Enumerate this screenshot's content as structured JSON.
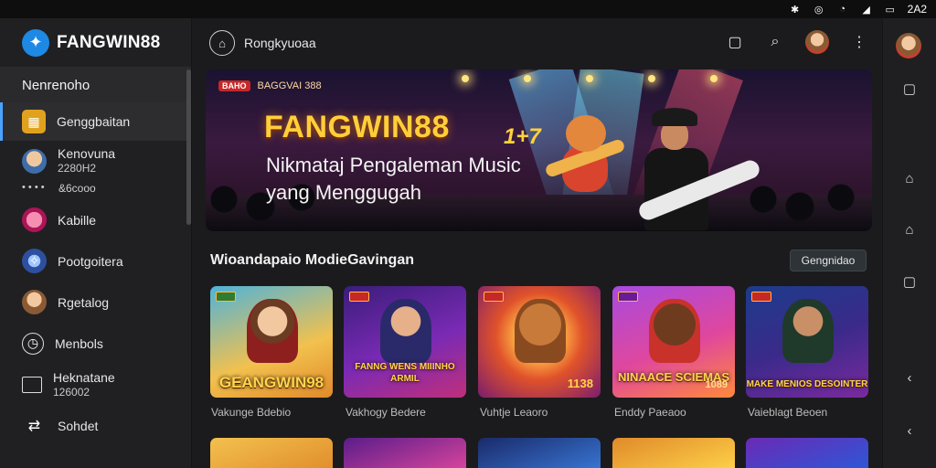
{
  "status_bar": {
    "time": "2A2"
  },
  "sidebar": {
    "brand": "FANGWIN88",
    "section_title": "Nenrenoho",
    "items": [
      {
        "label": "Genggbaitan",
        "active": true
      },
      {
        "label": "Kenovuna",
        "sub": "2280H2"
      },
      {
        "label": "Kabille"
      },
      {
        "label": "Pootgoitera"
      },
      {
        "label": "Rgetalog"
      },
      {
        "label": "Menbols"
      },
      {
        "label": "Heknatane",
        "sub": "126002"
      },
      {
        "label": "Sohdet"
      }
    ],
    "dots_row": [
      "• • • •",
      "&6cooo"
    ]
  },
  "topbar": {
    "title": "Rongkyuoaa"
  },
  "hero": {
    "badge_tag": "BAHO",
    "badge_text": "BAGGVAI 388",
    "title": "FANGWIN88",
    "mark": "1+7",
    "subtitle_line1": "Nikmataj Pengaleman Music",
    "subtitle_line2": "yang Menggugah"
  },
  "section": {
    "title": "Wioandapaio ModieGavingan",
    "button": "Gengnidao"
  },
  "cards": [
    {
      "label": "GEANGWIN98",
      "caption": "Vakunge Bdebio",
      "num": ""
    },
    {
      "label": "FANNG WENS MIIINHO ARMIL",
      "caption": "Vakhogy Bedere",
      "num": ""
    },
    {
      "label": "",
      "caption": "Vuhtje Leaoro",
      "num": "1138"
    },
    {
      "label": "NINAACE SCIEMAS",
      "caption": "Enddy Paeaoo",
      "num": "1089"
    },
    {
      "label": "MAKE MENIOS DESOINTER",
      "caption": "Vaieblagt Beoen",
      "num": ""
    }
  ],
  "colors": {
    "accent": "#4aa3ff",
    "title_gold": "#ffcf3a",
    "badge_red": "#c62828"
  }
}
